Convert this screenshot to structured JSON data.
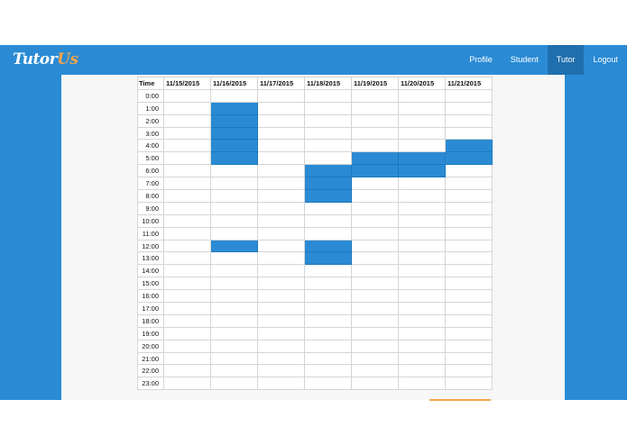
{
  "brand": {
    "name_main": "Tutor",
    "name_accent": "Us",
    "accent_color": "#f5a44a"
  },
  "colors": {
    "primary": "#2a8bd4",
    "nav_active": "#1f6fae"
  },
  "nav": {
    "items": [
      "Profile",
      "Student",
      "Tutor",
      "Logout"
    ],
    "active": "Tutor"
  },
  "calendar": {
    "header_time": "Time",
    "dates": [
      "11/15/2015",
      "11/16/2015",
      "11/17/2015",
      "11/18/2015",
      "11/19/2015",
      "11/20/2015",
      "11/21/2015"
    ],
    "hours": [
      "0:00",
      "1:00",
      "2:00",
      "3:00",
      "4:00",
      "5:00",
      "6:00",
      "7:00",
      "8:00",
      "9:00",
      "10:00",
      "11:00",
      "12:00",
      "13:00",
      "14:00",
      "15:00",
      "16:00",
      "17:00",
      "18:00",
      "19:00",
      "20:00",
      "21:00",
      "22:00",
      "23:00"
    ],
    "booked": {
      "11/16/2015": [
        "1:00",
        "2:00",
        "3:00",
        "4:00",
        "5:00",
        "12:00"
      ],
      "11/18/2015": [
        "6:00",
        "7:00",
        "8:00",
        "12:00",
        "13:00"
      ],
      "11/19/2015": [
        "5:00",
        "6:00"
      ],
      "11/20/2015": [
        "5:00",
        "6:00"
      ],
      "11/21/2015": [
        "4:00",
        "5:00"
      ]
    }
  }
}
